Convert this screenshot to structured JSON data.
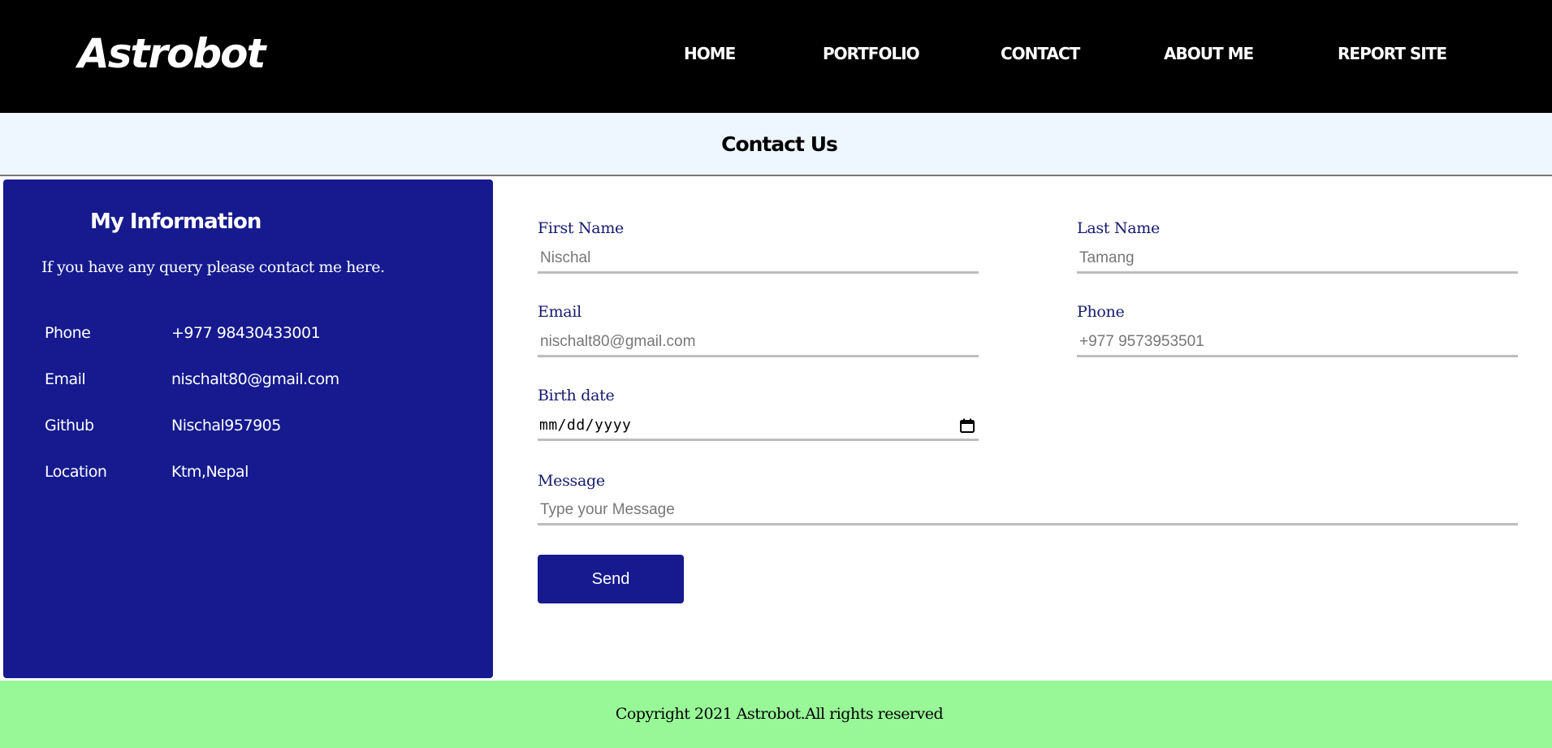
{
  "header": {
    "logo": "Astrobot",
    "nav": [
      "HOME",
      "PORTFOLIO",
      "CONTACT",
      "ABOUT ME",
      "REPORT SITE"
    ]
  },
  "page_title": "Contact Us",
  "info": {
    "heading": "My Information",
    "subtitle": "If you have any query please contact me here.",
    "rows": [
      {
        "label": "Phone",
        "value": "+977 98430433001"
      },
      {
        "label": "Email",
        "value": "nischalt80@gmail.com"
      },
      {
        "label": "Github",
        "value": "Nischal957905"
      },
      {
        "label": "Location",
        "value": "Ktm,Nepal"
      }
    ]
  },
  "form": {
    "first_name": {
      "label": "First Name",
      "placeholder": "Nischal"
    },
    "last_name": {
      "label": "Last Name",
      "placeholder": "Tamang"
    },
    "email": {
      "label": "Email",
      "placeholder": "nischalt80@gmail.com"
    },
    "phone": {
      "label": "Phone",
      "placeholder": "+977 9573953501"
    },
    "birth_date": {
      "label": "Birth date",
      "value": "mm/dd/yyyy"
    },
    "message": {
      "label": "Message",
      "placeholder": "Type your Message"
    },
    "send_label": "Send"
  },
  "footer": {
    "copyright": "Copyright 2021 Astrobot.All rights reserved"
  },
  "colors": {
    "header_bg": "#000000",
    "panel_bg": "#161a8e",
    "title_band_bg": "#eef6ff",
    "footer_bg": "#98f898",
    "label_color": "#161a6e"
  }
}
